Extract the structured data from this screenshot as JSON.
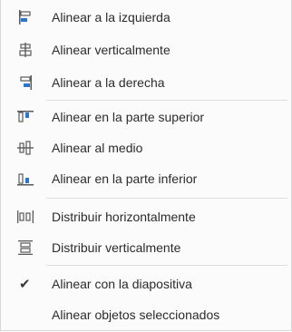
{
  "menu": {
    "items": [
      {
        "label": "Alinear a la izquierda",
        "icon": "align-left-icon"
      },
      {
        "label": "Alinear verticalmente",
        "icon": "align-center-vertical-icon"
      },
      {
        "label": "Alinear a la derecha",
        "icon": "align-right-icon"
      },
      {
        "label": "Alinear en la parte superior",
        "icon": "align-top-icon"
      },
      {
        "label": "Alinear al medio",
        "icon": "align-middle-icon"
      },
      {
        "label": "Alinear en la parte inferior",
        "icon": "align-bottom-icon"
      },
      {
        "label": "Distribuir horizontalmente",
        "icon": "distribute-horizontal-icon"
      },
      {
        "label": "Distribuir verticalmente",
        "icon": "distribute-vertical-icon"
      },
      {
        "label": "Alinear con la diapositiva",
        "icon": "checkmark-icon",
        "checked": true
      },
      {
        "label": "Alinear objetos seleccionados",
        "icon": ""
      }
    ],
    "accent_color": "#2e74c9",
    "icon_color": "#5a5a5a"
  }
}
